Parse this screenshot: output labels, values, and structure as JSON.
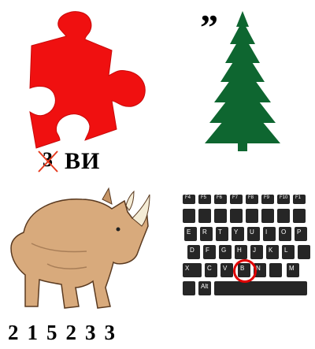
{
  "panel1": {
    "crossed_digit": "3",
    "word": "ВИ",
    "colors": {
      "puzzle": "#f01010",
      "cross": "#e63b1f"
    },
    "icon": "puzzle-piece"
  },
  "panel2": {
    "quote": "”",
    "colors": {
      "tree": "#0e6630"
    },
    "icon": "fir-tree"
  },
  "panel3": {
    "numbers": [
      "2",
      "1",
      "5",
      "2",
      "3",
      "3"
    ],
    "colors": {
      "skin": "#d8aa7c",
      "horn": "#f4ecd6"
    },
    "icon": "rhino"
  },
  "panel4": {
    "fkeys": [
      "F4",
      "F5",
      "F6",
      "F7",
      "F8",
      "F9",
      "F10",
      "F1"
    ],
    "row_qwerty": [
      "E",
      "R",
      "T",
      "Y",
      "U",
      "I",
      "O",
      "P"
    ],
    "row_asdf": [
      "D",
      "F",
      "G",
      "H",
      "J",
      "K",
      "L"
    ],
    "row_zxcv": [
      "X",
      "C",
      "V",
      "B",
      "N",
      "M"
    ],
    "alt_label": "Alt",
    "highlighted_key": "B",
    "colors": {
      "key": "#262626",
      "circle": "#e00000"
    },
    "icon": "keyboard"
  }
}
